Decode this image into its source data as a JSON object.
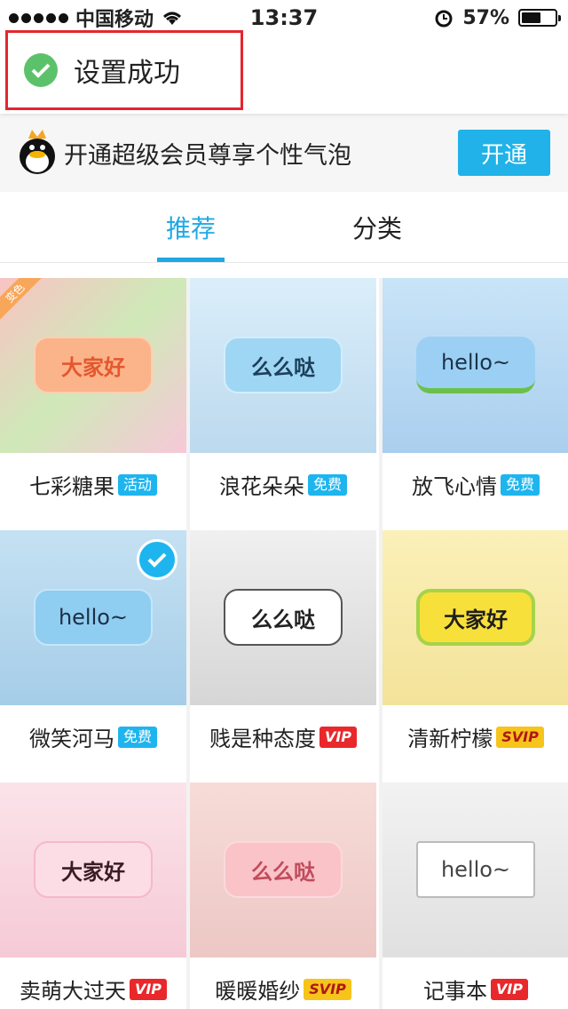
{
  "status_bar": {
    "carrier": "中国移动",
    "time": "13:37",
    "battery_percent": "57%",
    "battery_level": 0.57
  },
  "toast": {
    "text": "设置成功"
  },
  "promo": {
    "text": "开通超级会员尊享个性气泡",
    "button": "开通"
  },
  "tabs": [
    {
      "label": "推荐",
      "active": true
    },
    {
      "label": "分类",
      "active": false
    }
  ],
  "bubbles": [
    {
      "name": "七彩糖果",
      "badge": "活动",
      "badge_type": "act",
      "preview": "大家好",
      "corner": "变色"
    },
    {
      "name": "浪花朵朵",
      "badge": "免费",
      "badge_type": "free",
      "preview": "么么哒"
    },
    {
      "name": "放飞心情",
      "badge": "免费",
      "badge_type": "free",
      "preview": "hello~"
    },
    {
      "name": "微笑河马",
      "badge": "免费",
      "badge_type": "free",
      "preview": "hello~",
      "selected": true
    },
    {
      "name": "贱是种态度",
      "badge": "VIP",
      "badge_type": "vip",
      "preview": "么么哒"
    },
    {
      "name": "清新柠檬",
      "badge": "SVIP",
      "badge_type": "svip",
      "preview": "大家好"
    },
    {
      "name": "卖萌大过天",
      "badge": "VIP",
      "badge_type": "vip",
      "preview": "大家好"
    },
    {
      "name": "暖暖婚纱",
      "badge": "SVIP",
      "badge_type": "svip",
      "preview": "么么哒"
    },
    {
      "name": "记事本",
      "badge": "VIP",
      "badge_type": "vip",
      "preview": "hello~"
    }
  ]
}
